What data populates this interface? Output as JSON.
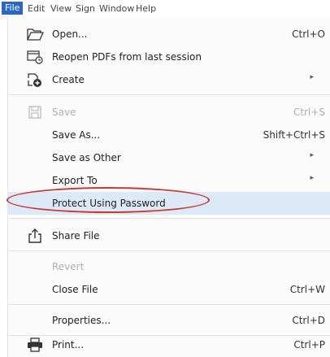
{
  "menubar": {
    "items": [
      "File",
      "Edit",
      "View",
      "Sign",
      "Window",
      "Help"
    ]
  },
  "menu": {
    "open": {
      "label": "Open...",
      "shortcut": "Ctrl+O"
    },
    "reopen": {
      "label": "Reopen PDFs from last session"
    },
    "create": {
      "label": "Create"
    },
    "save": {
      "label": "Save",
      "shortcut": "Ctrl+S"
    },
    "save_as": {
      "label": "Save As...",
      "shortcut": "Shift+Ctrl+S"
    },
    "save_as_other": {
      "label": "Save as Other"
    },
    "export_to": {
      "label": "Export To"
    },
    "protect": {
      "label": "Protect Using Password"
    },
    "share": {
      "label": "Share File"
    },
    "revert": {
      "label": "Revert"
    },
    "close": {
      "label": "Close File",
      "shortcut": "Ctrl+W"
    },
    "properties": {
      "label": "Properties...",
      "shortcut": "Ctrl+D"
    },
    "print": {
      "label": "Print...",
      "shortcut": "Ctrl+P"
    }
  },
  "colors": {
    "menubar_active": "#2b66c7",
    "highlight": "#dde9f7",
    "annotation_oval": "#c83a30"
  },
  "icons": [
    "folder-open-icon",
    "reopen-icon",
    "create-icon",
    "save-icon",
    "share-icon",
    "print-icon"
  ]
}
